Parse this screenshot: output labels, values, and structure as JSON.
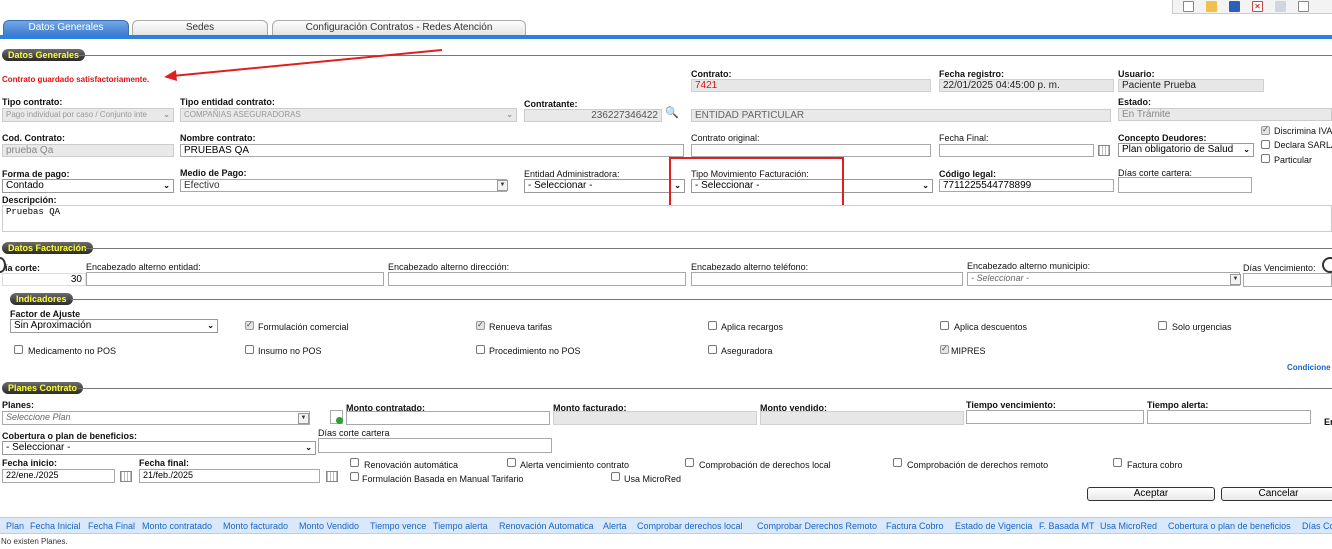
{
  "tabs": [
    {
      "label": "Datos Generales"
    },
    {
      "label": "Sedes"
    },
    {
      "label": "Configuración Contratos - Redes Atención"
    }
  ],
  "sections": {
    "general": "Datos Generales",
    "billing": "Datos Facturación",
    "indicators": "Indicadores",
    "plans": "Planes Contrato"
  },
  "message": "Contrato guardado satisfactoriamente.",
  "general": {
    "contrato_label": "Contrato:",
    "contrato_value": "7421",
    "fecha_registro_label": "Fecha registro:",
    "fecha_registro_value": "22/01/2025 04:45:00 p. m.",
    "usuario_label": "Usuario:",
    "usuario_value": "Paciente Prueba",
    "tipo_contrato_label": "Tipo contrato:",
    "tipo_contrato_value": "Pago individual por caso / Conjunto inte",
    "tipo_entidad_label": "Tipo entidad contrato:",
    "tipo_entidad_value": "COMPAÑIAS ASEGURADORAS",
    "contratante_label": "Contratante:",
    "contratante_id": "236227346422",
    "contratante_name": "ENTIDAD PARTICULAR",
    "estado_label": "Estado:",
    "estado_value": "En Trámite",
    "cod_contrato_label": "Cod. Contrato:",
    "cod_contrato_value": "prueba Qa",
    "nombre_contrato_label": "Nombre contrato:",
    "nombre_contrato_value": "PRUEBAS QA",
    "contrato_original_label": "Contrato original:",
    "fecha_final_label": "Fecha Final:",
    "concepto_deudores_label": "Concepto Deudores:",
    "concepto_deudores_value": "Plan obligatorio de Salud",
    "discrimina_iva": "Discrimina IVA",
    "declara_sarlaft": "Declara SARLA",
    "particular": "Particular",
    "forma_pago_label": "Forma de pago:",
    "forma_pago_value": "Contado",
    "medio_pago_label": "Medio de Pago:",
    "medio_pago_value": "Efectivo",
    "entidad_admin_label": "Entidad Administradora:",
    "entidad_admin_value": "- Seleccionar -",
    "tipo_mov_label": "Tipo Movimiento Facturación:",
    "tipo_mov_value": "- Seleccionar -",
    "codigo_legal_label": "Código legal:",
    "codigo_legal_value": "7711225544778899",
    "dias_corte_cartera_label": "Días corte cartera:",
    "descripcion_label": "Descripción:",
    "descripcion_value": "Pruebas QA"
  },
  "billing": {
    "dia_corte_label": "ía corte:",
    "dia_corte_value": "30",
    "enc_entidad_label": "Encabezado alterno entidad:",
    "enc_direccion_label": "Encabezado alterno dirección:",
    "enc_telefono_label": "Encabezado alterno teléfono:",
    "enc_municipio_label": "Encabezado alterno municipio:",
    "enc_municipio_value": "- Seleccionar -",
    "dias_vencimiento_label": "Días Vencimiento:"
  },
  "indicators": {
    "factor_label": "Factor de Ajuste",
    "factor_value": "Sin Aproximación",
    "checks": [
      {
        "label": "Formulación comercial",
        "checked": true
      },
      {
        "label": "Renueva tarifas",
        "checked": true
      },
      {
        "label": "Aplica recargos",
        "checked": false
      },
      {
        "label": "Aplica descuentos",
        "checked": false
      },
      {
        "label": "Solo urgencias",
        "checked": false
      },
      {
        "label": "Medicamento no POS",
        "checked": false
      },
      {
        "label": "Insumo no POS",
        "checked": false
      },
      {
        "label": "Procedimiento no POS",
        "checked": false
      },
      {
        "label": "Aseguradora",
        "checked": false
      },
      {
        "label": "MIPRES",
        "checked": true
      }
    ],
    "condiciones_link": "Condicione"
  },
  "plans": {
    "planes_label": "Planes:",
    "planes_value": "Seleccione Plan",
    "monto_contratado_label": "Monto contratado:",
    "monto_facturado_label": "Monto facturado:",
    "monto_vendido_label": "Monto vendido:",
    "tiempo_vencimiento_label": "Tiempo vencimiento:",
    "tiempo_alerta_label": "Tiempo alerta:",
    "en_label": "En",
    "cobertura_label": "Cobertura o plan de beneficios:",
    "cobertura_value": "- Seleccionar -",
    "dias_corte_cartera_label": "Días corte cartera",
    "fecha_inicio_label": "Fecha inicio:",
    "fecha_inicio_value": "22/ene./2025",
    "fecha_final_label": "Fecha final:",
    "fecha_final_value": "21/feb./2025",
    "renovacion": "Renovación automática",
    "alerta_venc": "Alerta vencimiento contrato",
    "comp_local": "Comprobación de derechos local",
    "comp_remoto": "Comprobación de derechos remoto",
    "factura_cobro": "Factura cobro",
    "formulacion_manual": "Formulación Basada en Manual Tarifario",
    "usa_microred": "Usa MicroRed",
    "aceptar": "Aceptar",
    "cancelar": "Cancelar"
  },
  "table": {
    "headers": [
      "Plan",
      "Fecha Inicial",
      "Fecha Final",
      "Monto contratado",
      "Monto facturado",
      "Monto Vendido",
      "Tiempo vence",
      "Tiempo alerta",
      "Renovación Automatica",
      "Alerta",
      "Comprobar derechos local",
      "Comprobar Derechos Remoto",
      "Factura Cobro",
      "Estado de Vigencia",
      "F. Basada MT",
      "Usa MicroRed",
      "Cobertura o plan de beneficios",
      "Días Co"
    ],
    "empty": "No existen Planes."
  },
  "colors": {
    "accent": "#2f7fe0",
    "error": "#e01010",
    "highlight_box": "#e02020",
    "section_text": "#ffff33"
  }
}
